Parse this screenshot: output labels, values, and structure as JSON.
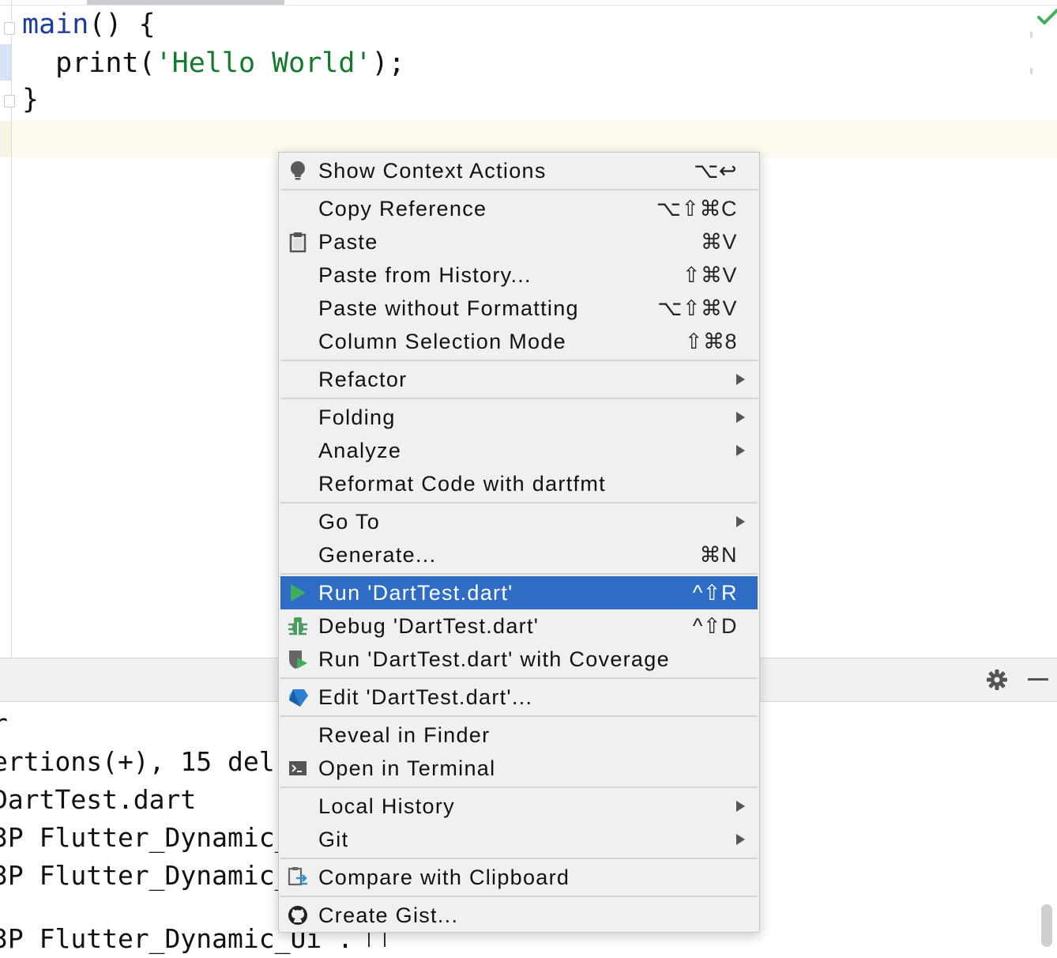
{
  "editor": {
    "code_lines": [
      {
        "fn": "main",
        "rest": "() {"
      },
      {
        "indent": "  ",
        "fn": "print",
        "open": "(",
        "string": "'Hello World'",
        "close": ");"
      },
      {
        "rest": "}"
      }
    ]
  },
  "console": {
    "lines": [
      "r",
      "ertions(+), 15 del",
      "DartTest.dart",
      "3P Flutter_Dynamic_",
      "3P Flutter_Dynamic_",
      "3P Flutter_Dynamic_Ui ."
    ]
  },
  "context_menu": {
    "items": [
      {
        "label": "Show Context Actions",
        "shortcut": "⌥↩",
        "icon": "lightbulb-icon"
      },
      {
        "label": "Copy Reference",
        "shortcut": "⌥⇧⌘C"
      },
      {
        "label": "Paste",
        "shortcut": "⌘V",
        "icon": "clipboard-icon"
      },
      {
        "label": "Paste from History...",
        "shortcut": "⇧⌘V"
      },
      {
        "label": "Paste without Formatting",
        "shortcut": "⌥⇧⌘V"
      },
      {
        "label": "Column Selection Mode",
        "shortcut": "⇧⌘8"
      },
      {
        "label": "Refactor",
        "submenu": true
      },
      {
        "label": "Folding",
        "submenu": true
      },
      {
        "label": "Analyze",
        "submenu": true
      },
      {
        "label": "Reformat Code with dartfmt"
      },
      {
        "label": "Go To",
        "submenu": true
      },
      {
        "label": "Generate...",
        "shortcut": "⌘N"
      },
      {
        "label": "Run 'DartTest.dart'",
        "shortcut": "^⇧R",
        "icon": "run-icon",
        "selected": true
      },
      {
        "label": "Debug 'DartTest.dart'",
        "shortcut": "^⇧D",
        "icon": "bug-icon"
      },
      {
        "label": "Run 'DartTest.dart' with Coverage",
        "icon": "coverage-icon"
      },
      {
        "label": "Edit 'DartTest.dart'...",
        "icon": "dart-icon"
      },
      {
        "label": "Reveal in Finder"
      },
      {
        "label": "Open in Terminal",
        "icon": "terminal-icon"
      },
      {
        "label": "Local History",
        "submenu": true
      },
      {
        "label": "Git",
        "submenu": true
      },
      {
        "label": "Compare with Clipboard",
        "icon": "compare-icon"
      },
      {
        "label": "Create Gist...",
        "icon": "github-icon"
      }
    ]
  },
  "colors": {
    "selection": "#2f6cc6",
    "function": "#1c3b9c",
    "string": "#137a2d",
    "run_green": "#3fae5a"
  }
}
